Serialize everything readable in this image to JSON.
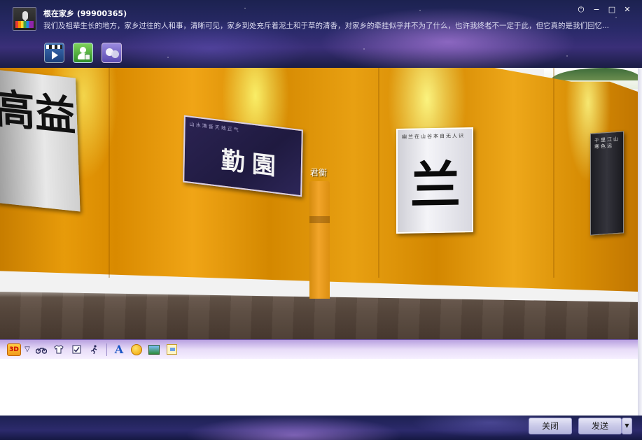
{
  "header": {
    "group_title": "根在家乡 (99900365)",
    "group_notice": "我们及祖辈生长的地方，家乡过往的人和事，清晰可见，家乡到处充斥着泥土和于草的清香，对家乡的牵挂似乎并不为了什么，也许我终老不一定于此，但它真的是我们回忆...",
    "window_controls": {
      "power": "⏻",
      "minimize": "−",
      "maximize": "□",
      "close": "✕"
    }
  },
  "scene": {
    "avatar_name": "君衡",
    "calligraphy_left": "高益",
    "calligraphy_mid_seals": [
      "勤",
      "園"
    ],
    "calligraphy_right": "兰",
    "mid_small_text": "山水清音天地正气",
    "right_small_text": "幽兰在山谷本自无人识",
    "far_small_text": "千里江山寒色远"
  },
  "toolbar": {
    "mode_3d": "3D",
    "mode_arrow": "▽",
    "font_icon": "A"
  },
  "input": {
    "value": ""
  },
  "footer": {
    "close_label": "关闭",
    "send_label": "发送",
    "send_dropdown": "▼"
  },
  "colors": {
    "wall": "#e79b0a",
    "floor": "#5a4a3f",
    "title_bar": "#2a2a6a"
  }
}
